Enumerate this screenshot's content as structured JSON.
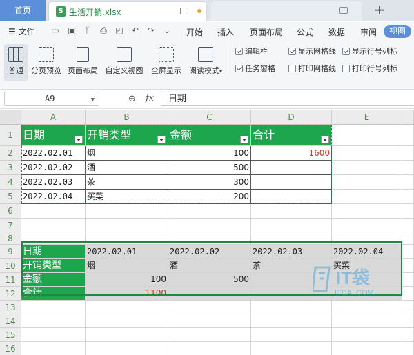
{
  "tabs": {
    "home": "首页",
    "file": "生活开销.xlsx",
    "file_icon": "S",
    "new_tab": "+"
  },
  "menubar": {
    "file_menu": "文件",
    "items": [
      "开始",
      "插入",
      "页面布局",
      "公式",
      "数据",
      "审阅"
    ],
    "active": "视图"
  },
  "ribbon": {
    "buttons": [
      "普通",
      "分页预览",
      "页面布局",
      "自定义视图",
      "全屏显示",
      "阅读模式"
    ],
    "checkboxes": [
      {
        "label": "编辑栏",
        "checked": true
      },
      {
        "label": "显示网格线",
        "checked": true
      },
      {
        "label": "显示行号列标",
        "checked": true
      },
      {
        "label": "任务窗格",
        "checked": true
      },
      {
        "label": "打印网格线",
        "checked": false
      },
      {
        "label": "打印行号列标",
        "checked": false
      }
    ]
  },
  "formula_bar": {
    "cell_ref": "A9",
    "fx": "fx",
    "value": "日期"
  },
  "sheet": {
    "columns": [
      "A",
      "B",
      "C",
      "D",
      "E"
    ],
    "rows": [
      "1",
      "2",
      "3",
      "4",
      "5",
      "6",
      "7",
      "8",
      "9",
      "10",
      "11",
      "12",
      "13",
      "14",
      "15",
      "16"
    ],
    "table1": {
      "headers": [
        "日期",
        "开销类型",
        "金额",
        "合计"
      ],
      "rows": [
        [
          "2022.02.01",
          "烟",
          "100",
          "1600"
        ],
        [
          "2022.02.02",
          "酒",
          "500",
          ""
        ],
        [
          "2022.02.03",
          "茶",
          "300",
          ""
        ],
        [
          "2022.02.04",
          "买菜",
          "200",
          ""
        ]
      ]
    },
    "table2": {
      "labels": [
        "日期",
        "开销类型",
        "金额",
        "合计"
      ],
      "dates": [
        "2022.02.01",
        "2022.02.02",
        "2022.02.03",
        "2022.02.04"
      ],
      "types": [
        "烟",
        "酒",
        "茶",
        "买菜"
      ],
      "amounts": [
        "100",
        "500",
        "",
        ""
      ],
      "total": "1100"
    }
  },
  "watermark": {
    "brand": "IT袋",
    "url": "ITDAI.COM"
  },
  "colors": {
    "accent": "#1ea64f",
    "brand_blue": "#5b8fd9",
    "red_value": "#c0392b"
  }
}
